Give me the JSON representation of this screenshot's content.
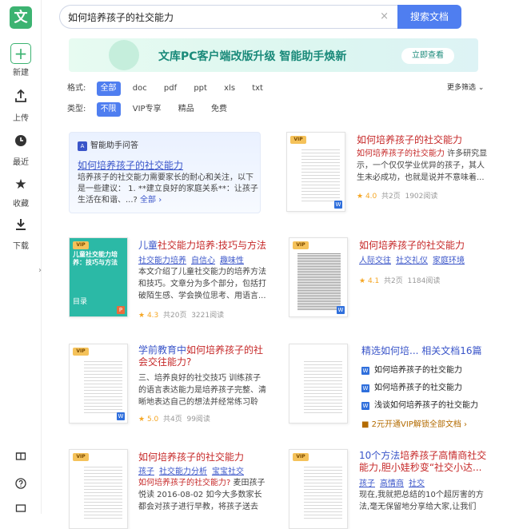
{
  "app": {
    "logo": "文"
  },
  "sidebar": {
    "items": [
      {
        "label": "新建",
        "icon": "plus-icon"
      },
      {
        "label": "上传",
        "icon": "upload-icon"
      },
      {
        "label": "最近",
        "icon": "clock-icon"
      },
      {
        "label": "收藏",
        "icon": "star-icon"
      },
      {
        "label": "下载",
        "icon": "download-icon"
      }
    ],
    "collapse_glyph": "›"
  },
  "search": {
    "value": "如何培养孩子的社交能力",
    "button": "搜索文档",
    "clear": "×"
  },
  "banner": {
    "text": "文库PC客户端改版升级 智能助手焕新",
    "button": "立即查看"
  },
  "filters": {
    "format_label": "格式:",
    "formats": [
      "全部",
      "doc",
      "pdf",
      "ppt",
      "xls",
      "txt"
    ],
    "type_label": "类型:",
    "types": [
      "不限",
      "VIP专享",
      "精品",
      "免费"
    ],
    "more": "更多筛选 ⌄"
  },
  "ai_answer": {
    "header": "智能助手问答",
    "title": "如何培养孩子的社交能力",
    "body": "培养孩子的社交能力需要家长的耐心和关注，以下是一些建议： 1. **建立良好的家庭关系**：让孩子生活在和谐、...?",
    "more": "全部 ›"
  },
  "results": [
    {
      "title_a": "",
      "title_b": "如何培养孩子的社交能力",
      "tags": [],
      "desc_red": "如何培养孩子的社交能力",
      "desc": " 许多研究显示，一个仅仅学业优异的孩子，其人生未必成功，也就是说并不意味着...",
      "rating": "4.0",
      "pages": "共2页",
      "views": "1902阅读"
    },
    {
      "title_a": "儿童",
      "title_b": "社交能力培养:技巧与方法",
      "tags": [
        "社交能力培养",
        "自信心",
        "趣味性"
      ],
      "desc_red": "",
      "desc": "本文介绍了儿童社交能力的培养方法和技巧。文章分为多个部分，包括打破陌生感、学会换位思考、用语言...",
      "rating": "4.3",
      "pages": "共20页",
      "views": "3221阅读",
      "cover_title": "儿童社交能力培养：技巧与方法",
      "cover_menu": "目录"
    },
    {
      "title_a": "",
      "title_b": "如何培养孩子的社交能力",
      "tags": [
        "人际交往",
        "社交礼仪",
        "家庭环境"
      ],
      "desc_red": "",
      "desc": "",
      "rating": "4.1",
      "pages": "共2页",
      "views": "1184阅读"
    },
    {
      "title_a": "学前教育中",
      "title_b": "如何培养孩子的社会交往能力?",
      "tags": [],
      "desc_red": "",
      "desc": "三、培养良好的社交技巧 训练孩子的语言表达能力是培养孩子完整、清晰地表达自己的想法并经常练习聆听、提...",
      "rating": "5.0",
      "pages": "共4页",
      "views": "99阅读"
    },
    {
      "title_a": "",
      "title_b": "如何培养孩子的社交能力",
      "tags": [
        "孩子",
        "社交能力分析",
        "宝宝社交"
      ],
      "desc_red": "如何培养孩子的社交能力?",
      "desc": " 麦田孩子悦读 2016-08-02 如今大多数家长都会对孩子进行早教，将孩子送去学...",
      "rating": "",
      "pages": "",
      "views": ""
    },
    {
      "title_a": "10个方法",
      "title_b": "培养孩子高情商社交能力,胆小娃秒变“社交小达...",
      "tags": [
        "孩子",
        "高情商",
        "社交"
      ],
      "desc_red": "",
      "desc": "现在,我就把总结的10个超厉害的方法,毫无保留地分享给大家,让我们一...",
      "rating": "",
      "pages": "",
      "views": ""
    }
  ],
  "related": {
    "title": "精选如何培... 相关文档16篇",
    "items": [
      "如何培养孩子的社交能力",
      "如何培养孩子的社交能力",
      "浅谈如何培养孩子的社交能力"
    ],
    "vip": "2元开通VIP解锁全部文档 ›"
  },
  "badges": {
    "vip": "VIP",
    "word": "W",
    "ppt": "P"
  }
}
